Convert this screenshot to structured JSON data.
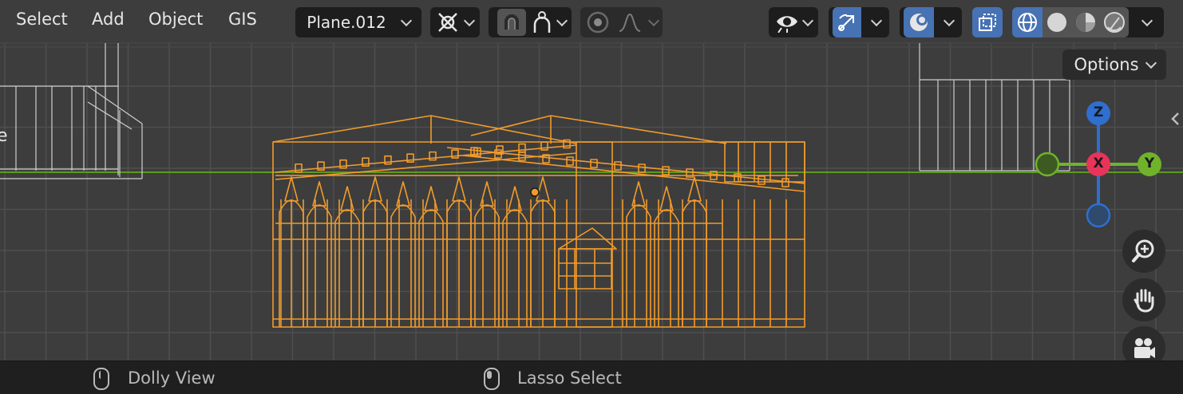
{
  "menu": {
    "select": "Select",
    "add": "Add",
    "object": "Object",
    "gis": "GIS"
  },
  "header": {
    "active_object": "Plane.012",
    "options_label": "Options"
  },
  "viewport": {
    "partial_label": "e",
    "axes": {
      "z": "Z",
      "x": "X",
      "y": "Y"
    }
  },
  "status": {
    "middle_mouse_action": "Dolly View",
    "left_mouse_action": "Lasso Select"
  },
  "colors": {
    "selection": "#f29b2b",
    "grid": "#545454",
    "background": "#3d3d3d",
    "x_axis": "#e8345a",
    "y_axis": "#6fb32a",
    "z_axis": "#2e6fd0",
    "header_button_active": "#4772b3"
  },
  "icons": {
    "transform_pivot": "pivot-icon",
    "snap": "snap-magnet-icon",
    "proportional": "proportional-edit-icon",
    "visibility": "eye-icon",
    "gizmo": "gizmo-icon",
    "overlays": "overlay-icon",
    "xray": "xray-icon",
    "shading": [
      "wireframe-shading-icon",
      "solid-shading-icon",
      "material-shading-icon",
      "rendered-shading-icon"
    ],
    "navigation": [
      "zoom-icon",
      "pan-hand-icon",
      "camera-icon"
    ]
  }
}
